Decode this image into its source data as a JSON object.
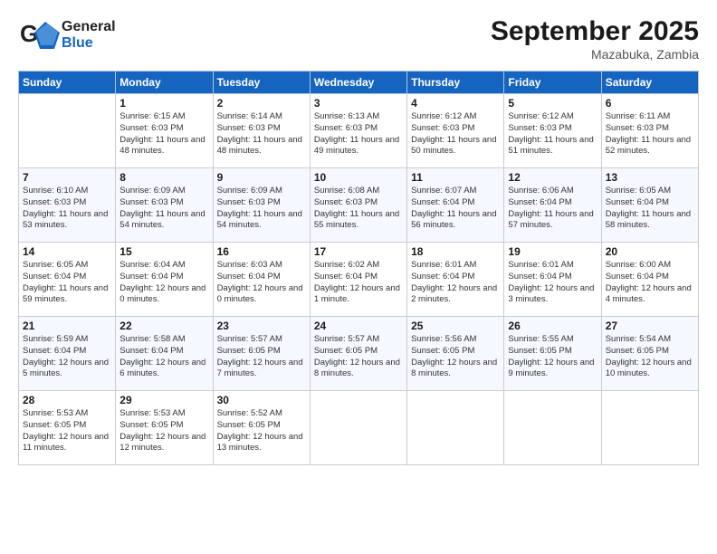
{
  "header": {
    "logo_general": "General",
    "logo_blue": "Blue",
    "month": "September 2025",
    "location": "Mazabuka, Zambia"
  },
  "weekdays": [
    "Sunday",
    "Monday",
    "Tuesday",
    "Wednesday",
    "Thursday",
    "Friday",
    "Saturday"
  ],
  "weeks": [
    [
      {
        "day": "",
        "info": ""
      },
      {
        "day": "1",
        "info": "Sunrise: 6:15 AM\nSunset: 6:03 PM\nDaylight: 11 hours\nand 48 minutes."
      },
      {
        "day": "2",
        "info": "Sunrise: 6:14 AM\nSunset: 6:03 PM\nDaylight: 11 hours\nand 48 minutes."
      },
      {
        "day": "3",
        "info": "Sunrise: 6:13 AM\nSunset: 6:03 PM\nDaylight: 11 hours\nand 49 minutes."
      },
      {
        "day": "4",
        "info": "Sunrise: 6:12 AM\nSunset: 6:03 PM\nDaylight: 11 hours\nand 50 minutes."
      },
      {
        "day": "5",
        "info": "Sunrise: 6:12 AM\nSunset: 6:03 PM\nDaylight: 11 hours\nand 51 minutes."
      },
      {
        "day": "6",
        "info": "Sunrise: 6:11 AM\nSunset: 6:03 PM\nDaylight: 11 hours\nand 52 minutes."
      }
    ],
    [
      {
        "day": "7",
        "info": "Sunrise: 6:10 AM\nSunset: 6:03 PM\nDaylight: 11 hours\nand 53 minutes."
      },
      {
        "day": "8",
        "info": "Sunrise: 6:09 AM\nSunset: 6:03 PM\nDaylight: 11 hours\nand 54 minutes."
      },
      {
        "day": "9",
        "info": "Sunrise: 6:09 AM\nSunset: 6:03 PM\nDaylight: 11 hours\nand 54 minutes."
      },
      {
        "day": "10",
        "info": "Sunrise: 6:08 AM\nSunset: 6:03 PM\nDaylight: 11 hours\nand 55 minutes."
      },
      {
        "day": "11",
        "info": "Sunrise: 6:07 AM\nSunset: 6:04 PM\nDaylight: 11 hours\nand 56 minutes."
      },
      {
        "day": "12",
        "info": "Sunrise: 6:06 AM\nSunset: 6:04 PM\nDaylight: 11 hours\nand 57 minutes."
      },
      {
        "day": "13",
        "info": "Sunrise: 6:05 AM\nSunset: 6:04 PM\nDaylight: 11 hours\nand 58 minutes."
      }
    ],
    [
      {
        "day": "14",
        "info": "Sunrise: 6:05 AM\nSunset: 6:04 PM\nDaylight: 11 hours\nand 59 minutes."
      },
      {
        "day": "15",
        "info": "Sunrise: 6:04 AM\nSunset: 6:04 PM\nDaylight: 12 hours\nand 0 minutes."
      },
      {
        "day": "16",
        "info": "Sunrise: 6:03 AM\nSunset: 6:04 PM\nDaylight: 12 hours\nand 0 minutes."
      },
      {
        "day": "17",
        "info": "Sunrise: 6:02 AM\nSunset: 6:04 PM\nDaylight: 12 hours\nand 1 minute."
      },
      {
        "day": "18",
        "info": "Sunrise: 6:01 AM\nSunset: 6:04 PM\nDaylight: 12 hours\nand 2 minutes."
      },
      {
        "day": "19",
        "info": "Sunrise: 6:01 AM\nSunset: 6:04 PM\nDaylight: 12 hours\nand 3 minutes."
      },
      {
        "day": "20",
        "info": "Sunrise: 6:00 AM\nSunset: 6:04 PM\nDaylight: 12 hours\nand 4 minutes."
      }
    ],
    [
      {
        "day": "21",
        "info": "Sunrise: 5:59 AM\nSunset: 6:04 PM\nDaylight: 12 hours\nand 5 minutes."
      },
      {
        "day": "22",
        "info": "Sunrise: 5:58 AM\nSunset: 6:04 PM\nDaylight: 12 hours\nand 6 minutes."
      },
      {
        "day": "23",
        "info": "Sunrise: 5:57 AM\nSunset: 6:05 PM\nDaylight: 12 hours\nand 7 minutes."
      },
      {
        "day": "24",
        "info": "Sunrise: 5:57 AM\nSunset: 6:05 PM\nDaylight: 12 hours\nand 8 minutes."
      },
      {
        "day": "25",
        "info": "Sunrise: 5:56 AM\nSunset: 6:05 PM\nDaylight: 12 hours\nand 8 minutes."
      },
      {
        "day": "26",
        "info": "Sunrise: 5:55 AM\nSunset: 6:05 PM\nDaylight: 12 hours\nand 9 minutes."
      },
      {
        "day": "27",
        "info": "Sunrise: 5:54 AM\nSunset: 6:05 PM\nDaylight: 12 hours\nand 10 minutes."
      }
    ],
    [
      {
        "day": "28",
        "info": "Sunrise: 5:53 AM\nSunset: 6:05 PM\nDaylight: 12 hours\nand 11 minutes."
      },
      {
        "day": "29",
        "info": "Sunrise: 5:53 AM\nSunset: 6:05 PM\nDaylight: 12 hours\nand 12 minutes."
      },
      {
        "day": "30",
        "info": "Sunrise: 5:52 AM\nSunset: 6:05 PM\nDaylight: 12 hours\nand 13 minutes."
      },
      {
        "day": "",
        "info": ""
      },
      {
        "day": "",
        "info": ""
      },
      {
        "day": "",
        "info": ""
      },
      {
        "day": "",
        "info": ""
      }
    ]
  ]
}
